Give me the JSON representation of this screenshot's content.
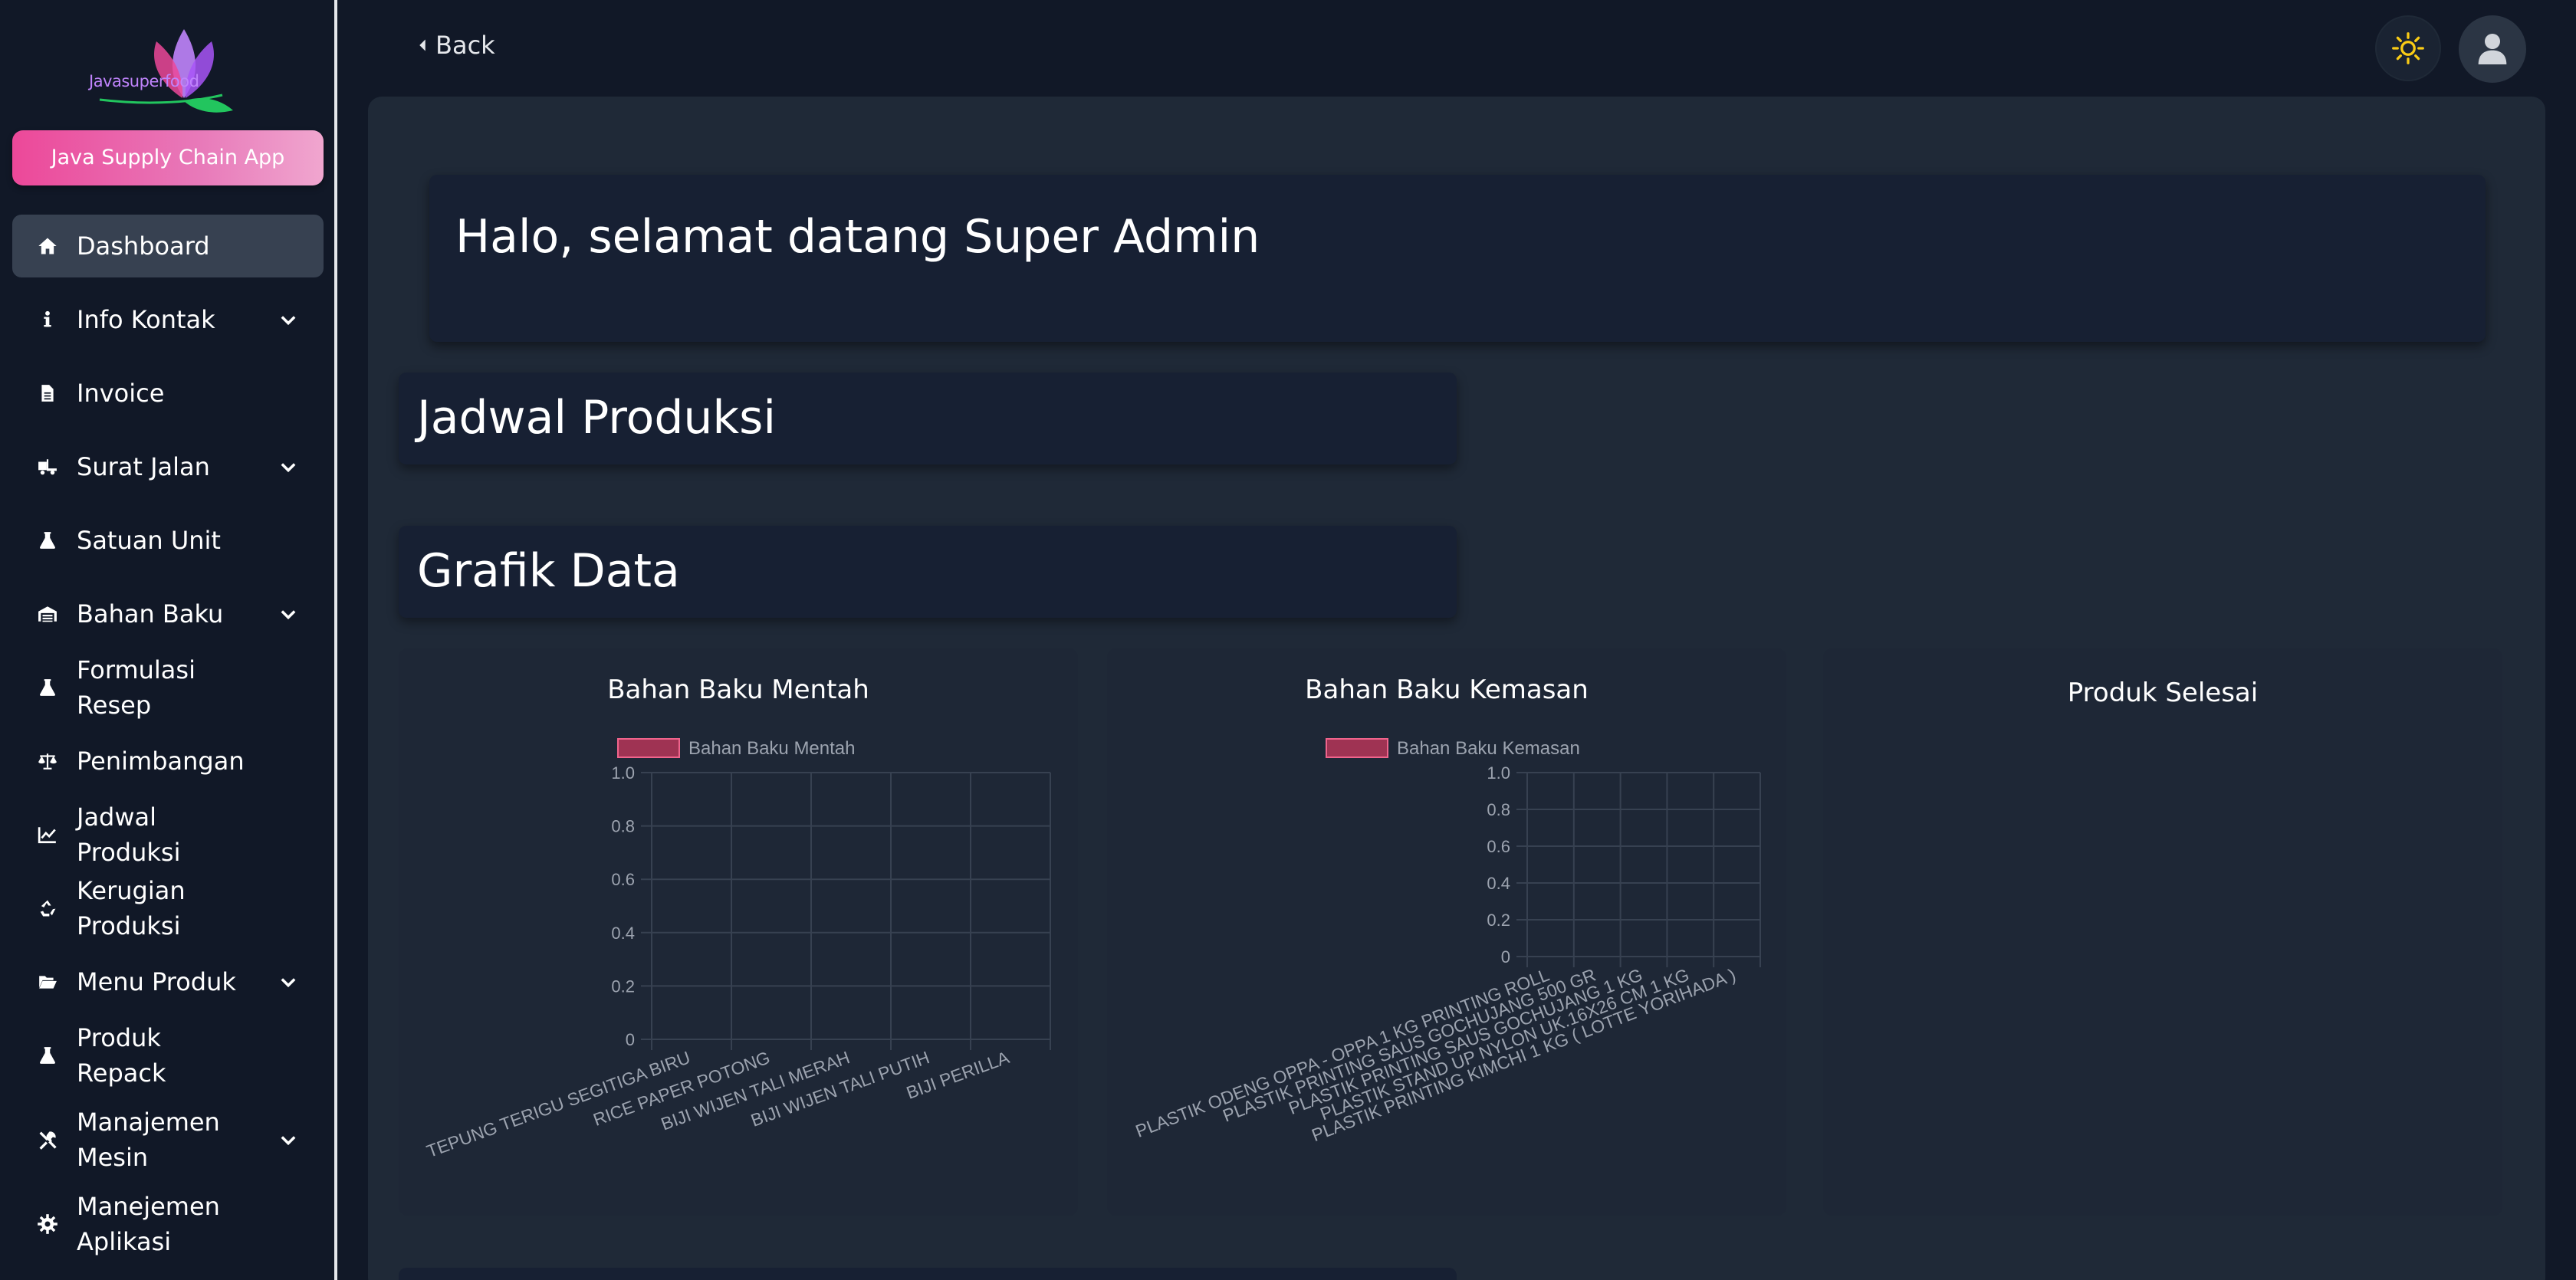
{
  "sidebar": {
    "logo_text": "Javasuperfood",
    "app_button": "Java Supply Chain App",
    "items": [
      {
        "label": "Dashboard",
        "icon": "home-icon",
        "chevron": false,
        "active": true
      },
      {
        "label": "Info Kontak",
        "icon": "info-icon",
        "chevron": true
      },
      {
        "label": "Invoice",
        "icon": "document-icon",
        "chevron": false
      },
      {
        "label": "Surat Jalan",
        "icon": "truck-icon",
        "chevron": true
      },
      {
        "label": "Satuan Unit",
        "icon": "flask-icon",
        "chevron": false
      },
      {
        "label": "Bahan Baku",
        "icon": "warehouse-icon",
        "chevron": true
      },
      {
        "label": "Formulasi Resep",
        "icon": "flask-icon",
        "chevron": false
      },
      {
        "label": "Penimbangan",
        "icon": "scale-icon",
        "chevron": false
      },
      {
        "label": "Jadwal Produksi",
        "icon": "chart-line-icon",
        "chevron": false
      },
      {
        "label": "Kerugian Produksi",
        "icon": "recycle-icon",
        "chevron": false
      },
      {
        "label": "Menu Produk",
        "icon": "folder-open-icon",
        "chevron": true
      },
      {
        "label": "Produk Repack",
        "icon": "flask-icon",
        "chevron": false
      },
      {
        "label": "Manajemen Mesin",
        "icon": "tools-icon",
        "chevron": true
      },
      {
        "label": "Manejemen Aplikasi",
        "icon": "gear-icon",
        "chevron": false
      }
    ]
  },
  "topbar": {
    "back_label": "Back",
    "theme_icon": "sun-icon",
    "user_icon": "user-icon"
  },
  "main": {
    "welcome": "Halo, selamat datang Super Admin",
    "section_schedule": "Jadwal Produksi",
    "section_chart": "Grafik Data"
  },
  "colors": {
    "accent_pink": "#ec4899",
    "legend_fill": "#9f3353",
    "legend_stroke": "#f0648c",
    "sun": "#facc15"
  },
  "chart_data": [
    {
      "type": "bar",
      "title": "Bahan Baku Mentah",
      "legend": "Bahan Baku Mentah",
      "categories": [
        "TEPUNG TERIGU SEGITIGA BIRU",
        "RICE PAPER POTONG",
        "BIJI WIJEN TALI MERAH",
        "BIJI WIJEN TALI PUTIH",
        "BIJI PERILLA"
      ],
      "values": [
        0,
        0,
        0,
        0,
        0
      ],
      "ylim": [
        0,
        1
      ],
      "yticks": [
        "1.0",
        "0.8",
        "0.6",
        "0.4",
        "0.2",
        "0"
      ],
      "grid": true,
      "legend_position": "top"
    },
    {
      "type": "bar",
      "title": "Bahan Baku Kemasan",
      "legend": "Bahan Baku Kemasan",
      "categories": [
        "PLASTIK ODENG OPPA - OPPA 1 KG PRINTING ROLL",
        "PLASTIK PRINTING SAUS GOCHUJANG 500 GR",
        "PLASTIK PRINTING SAUS GOCHUJANG 1 KG",
        "PLASTIK STAND UP NYLON UK.16X26 CM 1 KG",
        "PLASTIK PRINTING KIMCHI 1 KG ( LOTTE YORIHADA )"
      ],
      "values": [
        0,
        0,
        0,
        0,
        0
      ],
      "ylim": [
        0,
        1
      ],
      "yticks": [
        "1.0",
        "0.8",
        "0.6",
        "0.4",
        "0.2",
        "0"
      ],
      "grid": true,
      "legend_position": "top"
    },
    {
      "type": "bar",
      "title": "Produk Selesai",
      "categories": [],
      "values": []
    }
  ]
}
